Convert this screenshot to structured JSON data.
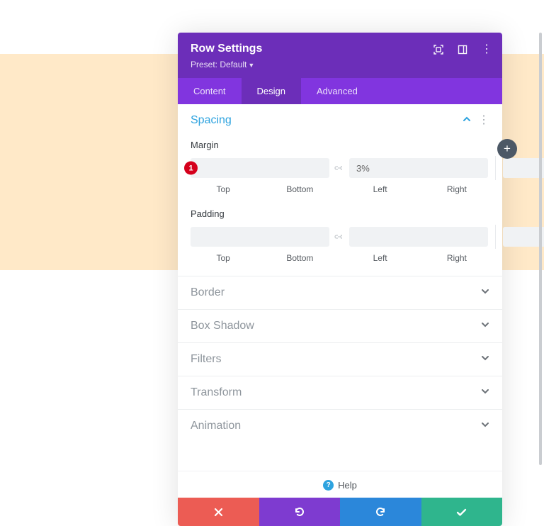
{
  "header": {
    "title": "Row Settings",
    "preset_label": "Preset: Default"
  },
  "tabs": {
    "content": "Content",
    "design": "Design",
    "advanced": "Advanced"
  },
  "sections": {
    "spacing": "Spacing",
    "border": "Border",
    "box_shadow": "Box Shadow",
    "filters": "Filters",
    "transform": "Transform",
    "animation": "Animation"
  },
  "spacing": {
    "margin_label": "Margin",
    "padding_label": "Padding",
    "margin": {
      "top": "",
      "bottom": "3%",
      "left": "",
      "right": ""
    },
    "padding": {
      "top": "",
      "bottom": "",
      "left": "",
      "right": ""
    },
    "labels": {
      "top": "Top",
      "bottom": "Bottom",
      "left": "Left",
      "right": "Right"
    }
  },
  "marker": {
    "number": "1"
  },
  "help": {
    "label": "Help"
  }
}
